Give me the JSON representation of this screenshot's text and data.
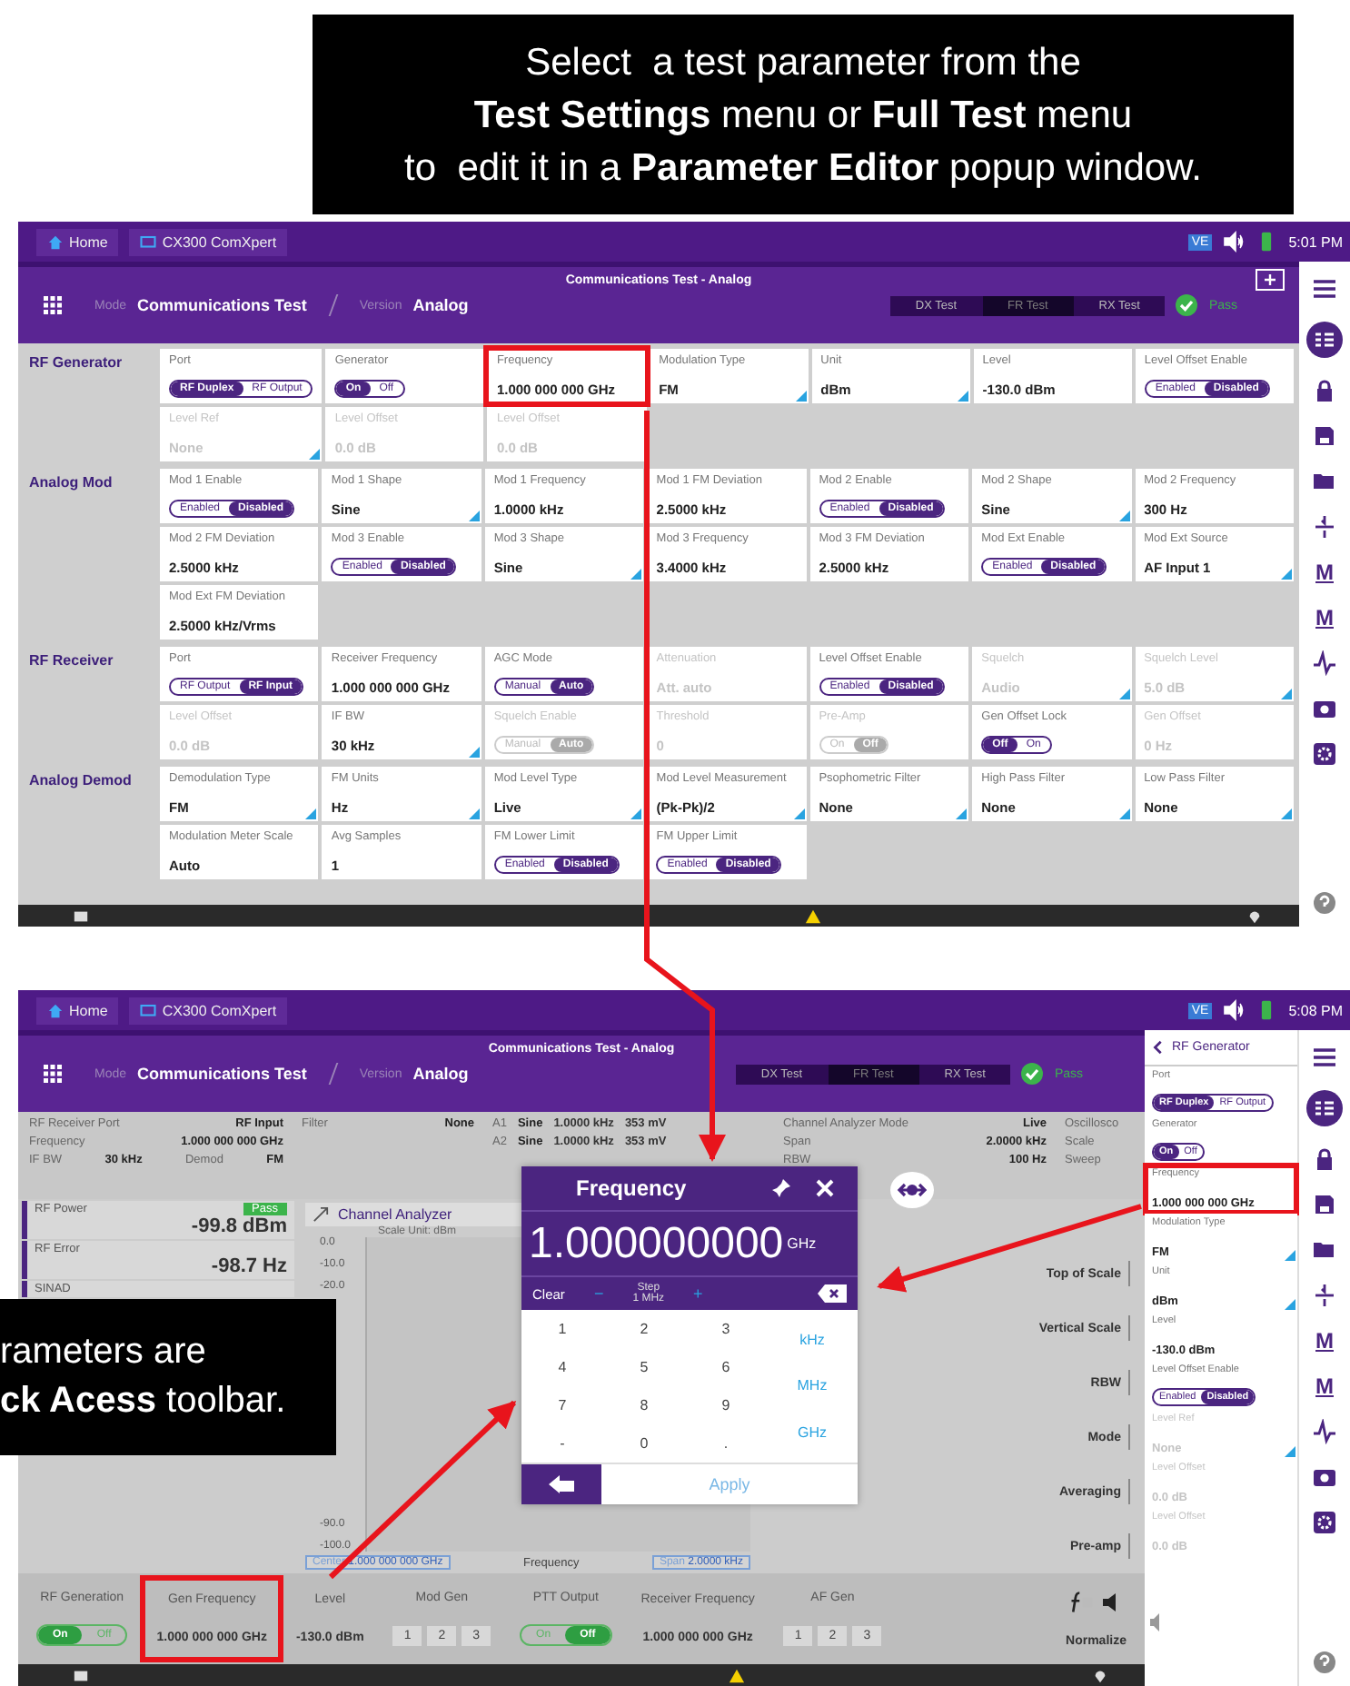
{
  "caption_top": {
    "lines": [
      "Select  a test parameter from the",
      "**Test Settings** menu or **Full Test** menu",
      "to  edit it in a **Parameter Editor** popup window."
    ]
  },
  "screen_1": {
    "nav": {
      "home": "Home",
      "app": "CX300 ComXpert",
      "badge": "VE",
      "time": "5:01 PM"
    },
    "title": "Communications Test - Analog",
    "mode_label": "Mode",
    "mode": "Communications Test",
    "version_label": "Version",
    "version": "Analog",
    "tests": [
      {
        "label": "DX Test",
        "selected": false
      },
      {
        "label": "FR Test",
        "selected": true
      },
      {
        "label": "RX Test",
        "selected": false
      }
    ],
    "status": "Pass",
    "sections": [
      {
        "name": "RF Generator",
        "params": [
          {
            "label": "Port",
            "kind": "toggle",
            "options": [
              {
                "label": "RF Duplex",
                "selected": true
              },
              {
                "label": "RF Output",
                "selected": false
              }
            ]
          },
          {
            "label": "Generator",
            "kind": "toggle",
            "options": [
              {
                "label": "On",
                "selected": true
              },
              {
                "label": "Off",
                "selected": false
              }
            ]
          },
          {
            "label": "Frequency",
            "kind": "value",
            "value": "1.000 000 000 GHz",
            "highlighted": true
          },
          {
            "label": "Modulation Type",
            "kind": "select",
            "value": "FM"
          },
          {
            "label": "Unit",
            "kind": "select",
            "value": "dBm"
          },
          {
            "label": "Level",
            "kind": "value",
            "value": "-130.0 dBm"
          },
          {
            "label": "Level Offset Enable",
            "kind": "toggle",
            "options": [
              {
                "label": "Enabled",
                "selected": false
              },
              {
                "label": "Disabled",
                "selected": true
              }
            ]
          },
          {
            "label": "Level Ref",
            "kind": "select",
            "value": "None",
            "disabled": true
          },
          {
            "label": "Level Offset",
            "kind": "value",
            "value": "0.0 dB",
            "disabled": true
          },
          {
            "label": "Level Offset",
            "kind": "value",
            "value": "0.0 dB",
            "disabled": true
          }
        ]
      },
      {
        "name": "Analog Mod",
        "params": [
          {
            "label": "Mod 1 Enable",
            "kind": "toggle",
            "options": [
              {
                "label": "Enabled",
                "selected": false
              },
              {
                "label": "Disabled",
                "selected": true
              }
            ]
          },
          {
            "label": "Mod 1 Shape",
            "kind": "select",
            "value": "Sine"
          },
          {
            "label": "Mod 1 Frequency",
            "kind": "value",
            "value": "1.0000 kHz"
          },
          {
            "label": "Mod 1 FM Deviation",
            "kind": "value",
            "value": "2.5000 kHz"
          },
          {
            "label": "Mod 2 Enable",
            "kind": "toggle",
            "options": [
              {
                "label": "Enabled",
                "selected": false
              },
              {
                "label": "Disabled",
                "selected": true
              }
            ]
          },
          {
            "label": "Mod 2 Shape",
            "kind": "select",
            "value": "Sine"
          },
          {
            "label": "Mod 2 Frequency",
            "kind": "value",
            "value": "300 Hz"
          },
          {
            "label": "Mod 2 FM Deviation",
            "kind": "value",
            "value": "2.5000 kHz"
          },
          {
            "label": "Mod 3 Enable",
            "kind": "toggle",
            "options": [
              {
                "label": "Enabled",
                "selected": false
              },
              {
                "label": "Disabled",
                "selected": true
              }
            ]
          },
          {
            "label": "Mod 3 Shape",
            "kind": "select",
            "value": "Sine"
          },
          {
            "label": "Mod 3 Frequency",
            "kind": "value",
            "value": "3.4000 kHz"
          },
          {
            "label": "Mod 3 FM Deviation",
            "kind": "value",
            "value": "2.5000 kHz"
          },
          {
            "label": "Mod Ext Enable",
            "kind": "toggle",
            "options": [
              {
                "label": "Enabled",
                "selected": false
              },
              {
                "label": "Disabled",
                "selected": true
              }
            ]
          },
          {
            "label": "Mod Ext Source",
            "kind": "select",
            "value": "AF Input 1"
          },
          {
            "label": "Mod Ext FM Deviation",
            "kind": "value",
            "value": "2.5000 kHz/Vrms"
          }
        ]
      },
      {
        "name": "RF Receiver",
        "params": [
          {
            "label": "Port",
            "kind": "toggle",
            "options": [
              {
                "label": "RF Output",
                "selected": false
              },
              {
                "label": "RF Input",
                "selected": true
              }
            ]
          },
          {
            "label": "Receiver Frequency",
            "kind": "value",
            "value": "1.000 000 000 GHz"
          },
          {
            "label": "AGC Mode",
            "kind": "toggle",
            "options": [
              {
                "label": "Manual",
                "selected": false
              },
              {
                "label": "Auto",
                "selected": true
              }
            ]
          },
          {
            "label": "Attenuation",
            "kind": "value",
            "value": "Att. auto",
            "disabled": true
          },
          {
            "label": "Level Offset Enable",
            "kind": "toggle",
            "options": [
              {
                "label": "Enabled",
                "selected": false
              },
              {
                "label": "Disabled",
                "selected": true
              }
            ]
          },
          {
            "label": "Squelch",
            "kind": "select",
            "value": "Audio",
            "disabled": true
          },
          {
            "label": "Squelch Level",
            "kind": "select",
            "value": "5.0 dB",
            "disabled": true
          },
          {
            "label": "Level Offset",
            "kind": "value",
            "value": "0.0 dB",
            "disabled": true
          },
          {
            "label": "IF BW",
            "kind": "select",
            "value": "30 kHz"
          },
          {
            "label": "Squelch Enable",
            "kind": "toggle",
            "disabled": true,
            "options": [
              {
                "label": "Manual",
                "selected": false
              },
              {
                "label": "Auto",
                "selected": true
              }
            ]
          },
          {
            "label": "Threshold",
            "kind": "value",
            "value": "0",
            "disabled": true
          },
          {
            "label": "Pre-Amp",
            "kind": "toggle",
            "disabled": true,
            "options": [
              {
                "label": "On",
                "selected": false
              },
              {
                "label": "Off",
                "selected": true
              }
            ]
          },
          {
            "label": "Gen Offset Lock",
            "kind": "toggle",
            "options": [
              {
                "label": "Off",
                "selected": true
              },
              {
                "label": "On",
                "selected": false
              }
            ]
          },
          {
            "label": "Gen Offset",
            "kind": "value",
            "value": "0 Hz",
            "disabled": true
          }
        ]
      },
      {
        "name": "Analog Demod",
        "params": [
          {
            "label": "Demodulation Type",
            "kind": "select",
            "value": "FM"
          },
          {
            "label": "FM Units",
            "kind": "select",
            "value": "Hz"
          },
          {
            "label": "Mod Level Type",
            "kind": "select",
            "value": "Live"
          },
          {
            "label": "Mod Level Measurement",
            "kind": "select",
            "value": "(Pk-Pk)/2"
          },
          {
            "label": "Psophometric Filter",
            "kind": "select",
            "value": "None"
          },
          {
            "label": "High Pass Filter",
            "kind": "select",
            "value": "None"
          },
          {
            "label": "Low Pass Filter",
            "kind": "select",
            "value": "None"
          },
          {
            "label": "Modulation Meter Scale",
            "kind": "value",
            "value": "Auto"
          },
          {
            "label": "Avg Samples",
            "kind": "value",
            "value": "1"
          },
          {
            "label": "FM Lower Limit",
            "kind": "toggle",
            "options": [
              {
                "label": "Enabled",
                "selected": false
              },
              {
                "label": "Disabled",
                "selected": true
              }
            ]
          },
          {
            "label": "FM Upper Limit",
            "kind": "toggle",
            "options": [
              {
                "label": "Enabled",
                "selected": false
              },
              {
                "label": "Disabled",
                "selected": true
              }
            ]
          }
        ]
      }
    ],
    "marker_buttons": [
      "M",
      "M"
    ]
  },
  "screen_2": {
    "nav": {
      "home": "Home",
      "app": "CX300 ComXpert",
      "badge": "VE",
      "time": "5:08 PM"
    },
    "title": "Communications Test - Analog",
    "mode_label": "Mode",
    "mode": "Communications Test",
    "version_label": "Version",
    "version": "Analog",
    "tests": [
      {
        "label": "DX Test",
        "selected": false
      },
      {
        "label": "FR Test",
        "selected": true
      },
      {
        "label": "RX Test",
        "selected": false
      }
    ],
    "status": "Pass",
    "receiver_info": [
      [
        "RF Receiver Port",
        "RF Input"
      ],
      [
        "Frequency",
        "1.000 000 000 GHz"
      ],
      [
        "IF BW",
        "30 kHz",
        "Demod",
        "FM"
      ]
    ],
    "filter": [
      "Filter",
      "None"
    ],
    "mod_rows": [
      [
        "A1",
        "Sine",
        "1.0000 kHz",
        "353 mV"
      ],
      [
        "A2",
        "Sine",
        "1.0000 kHz",
        "353 mV"
      ]
    ],
    "analyzer_info": [
      [
        "Channel Analyzer Mode",
        "Live"
      ],
      [
        "Span",
        "2.0000 kHz"
      ],
      [
        "RBW",
        "100 Hz"
      ]
    ],
    "scope_info": [
      "Oscillosco",
      "Scale",
      "Sweep"
    ],
    "meters": [
      {
        "label": "RF Power",
        "badge": "Pass",
        "value": "-99.8 dBm"
      },
      {
        "label": "RF Error",
        "value": "-98.7 Hz"
      },
      {
        "label": "SINAD"
      }
    ],
    "analyzer": {
      "title": "Channel Analyzer",
      "scale_unit": "Scale Unit: dBm",
      "upper_ticks": [
        "0.0",
        "-10.0",
        "-20.0"
      ],
      "lower_ticks": [
        "-90.0",
        "-100.0"
      ],
      "center_label": "Center",
      "center": "1.000 000 000 GHz",
      "axis": "Frequency",
      "span_label": "Span",
      "span": "2.0000 kHz"
    },
    "scale_settings": [
      "Top of Scale",
      "Vertical Scale",
      "RBW",
      "Mode",
      "Averaging",
      "Pre-amp"
    ],
    "editor": {
      "title": "Frequency",
      "value": "1.000000000",
      "unit": "GHz",
      "clear": "Clear",
      "step_label": "Step",
      "step": "1 MHz",
      "minus": "−",
      "plus": "+",
      "keys": [
        "1",
        "2",
        "3",
        "4",
        "5",
        "6",
        "7",
        "8",
        "9",
        "-",
        "0",
        "."
      ],
      "units": [
        "kHz",
        "MHz",
        "GHz"
      ],
      "apply": "Apply"
    },
    "toolbar": [
      {
        "label": "RF Generation",
        "kind": "toggle",
        "options": [
          {
            "label": "On",
            "selected": true
          },
          {
            "label": "Off",
            "selected": false
          }
        ]
      },
      {
        "label": "Gen Frequency",
        "kind": "value",
        "value": "1.000 000 000 GHz",
        "highlighted": true
      },
      {
        "label": "Level",
        "kind": "value",
        "value": "-130.0 dBm"
      },
      {
        "label": "Mod Gen",
        "kind": "buttons",
        "options": [
          "1",
          "2",
          "3"
        ]
      },
      {
        "label": "PTT Output",
        "kind": "toggle",
        "options": [
          {
            "label": "On",
            "selected": false
          },
          {
            "label": "Off",
            "selected": true
          }
        ]
      },
      {
        "label": "Receiver Frequency",
        "kind": "value",
        "value": "1.000 000 000 GHz"
      },
      {
        "label": "AF Gen",
        "kind": "buttons",
        "options": [
          "1",
          "2",
          "3"
        ]
      }
    ],
    "normalize": "Normalize",
    "panel": {
      "back": "RF Generator",
      "params": [
        {
          "label": "Port",
          "kind": "toggle",
          "options": [
            {
              "label": "RF Duplex",
              "selected": true
            },
            {
              "label": "RF Output",
              "selected": false
            }
          ]
        },
        {
          "label": "Generator",
          "kind": "toggle",
          "options": [
            {
              "label": "On",
              "selected": true
            },
            {
              "label": "Off",
              "selected": false
            }
          ]
        },
        {
          "label": "Frequency",
          "kind": "value",
          "value": "1.000 000 000 GHz",
          "highlighted": true
        },
        {
          "label": "Modulation Type",
          "kind": "select",
          "value": "FM"
        },
        {
          "label": "Unit",
          "kind": "select",
          "value": "dBm"
        },
        {
          "label": "Level",
          "kind": "value",
          "value": "-130.0 dBm"
        },
        {
          "label": "Level Offset Enable",
          "kind": "toggle",
          "options": [
            {
              "label": "Enabled",
              "selected": false
            },
            {
              "label": "Disabled",
              "selected": true
            }
          ]
        },
        {
          "label": "Level Ref",
          "kind": "select",
          "value": "None",
          "disabled": true
        },
        {
          "label": "Level Offset",
          "kind": "value",
          "value": "0.0 dB",
          "disabled": true
        },
        {
          "label": "Level Offset",
          "kind": "value",
          "value": "0.0 dB",
          "disabled": true
        }
      ]
    },
    "marker_buttons": [
      "M",
      "M"
    ]
  },
  "caption_bottom": {
    "lines": [
      "rameters are",
      "**ck Acess** toolbar."
    ]
  }
}
